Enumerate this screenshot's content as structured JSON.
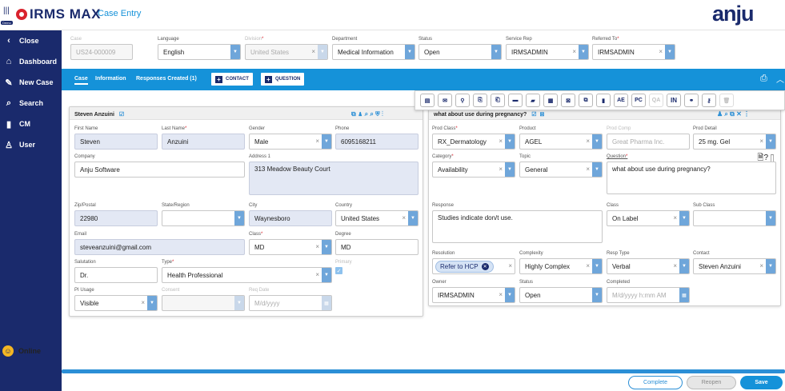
{
  "app": {
    "brand": "IRMS MAX",
    "page": "Case Entry",
    "logo": "anju",
    "env_badge": "Demo"
  },
  "sidebar": {
    "items": [
      {
        "label": "Close",
        "icon": "chevron-left-icon"
      },
      {
        "label": "Dashboard",
        "icon": "home-icon"
      },
      {
        "label": "New Case",
        "icon": "new-case-icon"
      },
      {
        "label": "Search",
        "icon": "search-icon"
      },
      {
        "label": "CM",
        "icon": "bookmark-icon"
      },
      {
        "label": "User",
        "icon": "user-icon"
      }
    ],
    "status": "Online"
  },
  "header": {
    "case": {
      "label": "Case",
      "value": "US24-000009"
    },
    "language": {
      "label": "Language",
      "value": "English"
    },
    "division": {
      "label": "Division",
      "value": "United States"
    },
    "department": {
      "label": "Department",
      "value": "Medical Information"
    },
    "status": {
      "label": "Status",
      "value": "Open"
    },
    "service_rep": {
      "label": "Service Rep",
      "value": "IRMSADMIN"
    },
    "referred_to": {
      "label": "Referred To",
      "value": "IRMSADMIN"
    }
  },
  "tabs": {
    "case": "Case",
    "information": "Information",
    "responses": "Responses Created (1)",
    "contact_btn": "CONTACT",
    "question_btn": "QUESTION"
  },
  "toolbar": {
    "ae": "AE",
    "pc": "PC",
    "qa": "QA",
    "in": "IN"
  },
  "contact": {
    "title": "Steven Anzuini",
    "first_name": {
      "label": "First Name",
      "value": "Steven"
    },
    "last_name": {
      "label": "Last Name",
      "value": "Anzuini"
    },
    "gender": {
      "label": "Gender",
      "value": "Male"
    },
    "phone": {
      "label": "Phone",
      "value": "6095168211"
    },
    "company": {
      "label": "Company",
      "value": "Anju Software"
    },
    "address1": {
      "label": "Address 1",
      "value": "313 Meadow Beauty Court"
    },
    "zip": {
      "label": "Zip/Postal",
      "value": "22980"
    },
    "state": {
      "label": "State/Region",
      "value": ""
    },
    "city": {
      "label": "City",
      "value": "Waynesboro"
    },
    "country": {
      "label": "Country",
      "value": "United States"
    },
    "email": {
      "label": "Email",
      "value": "steveanzuini@gmail.com"
    },
    "class": {
      "label": "Class",
      "value": "MD"
    },
    "degree": {
      "label": "Degree",
      "value": "MD"
    },
    "salutation": {
      "label": "Salutation",
      "value": "Dr."
    },
    "type": {
      "label": "Type",
      "value": "Health Professional"
    },
    "primary": {
      "label": "Primary"
    },
    "pi_usage": {
      "label": "PI Usage",
      "value": "Visible"
    },
    "consent": {
      "label": "Consent",
      "value": ""
    },
    "req_date": {
      "label": "Req Date",
      "placeholder": "M/d/yyyy"
    }
  },
  "question": {
    "title": "what about use during pregnancy?",
    "prod_class": {
      "label": "Prod Class",
      "value": "RX_Dermatology"
    },
    "product": {
      "label": "Product",
      "value": "AGEL"
    },
    "prod_comp": {
      "label": "Prod Comp",
      "placeholder": "Great Pharma Inc."
    },
    "prod_detail": {
      "label": "Prod Detail",
      "value": "25 mg. Gel"
    },
    "category": {
      "label": "Category",
      "value": "Availability"
    },
    "topic": {
      "label": "Topic",
      "value": "General"
    },
    "question_field": {
      "label": "Question",
      "value": "what about use during pregnancy?"
    },
    "response": {
      "label": "Response",
      "value": "Studies indicate don/t use."
    },
    "class": {
      "label": "Class",
      "value": "On Label"
    },
    "sub_class": {
      "label": "Sub Class",
      "value": ""
    },
    "resolution": {
      "label": "Resolution",
      "chip": "Refer to HCP"
    },
    "complexity": {
      "label": "Complexity",
      "value": "Highly Complex"
    },
    "resp_type": {
      "label": "Resp Type",
      "value": "Verbal"
    },
    "contact": {
      "label": "Contact",
      "value": "Steven Anzuini"
    },
    "owner": {
      "label": "Owner",
      "value": "IRMSADMIN"
    },
    "status": {
      "label": "Status",
      "value": "Open"
    },
    "completed": {
      "label": "Completed",
      "placeholder": "M/d/yyyy h:mm AM"
    }
  },
  "footer": {
    "complete": "Complete",
    "reopen": "Reopen",
    "save": "Save"
  },
  "colors": {
    "navy": "#1a2a6c",
    "blue": "#1592d9",
    "dropdown": "#6fa6da",
    "fill": "#e3e8f4",
    "accent_red": "#d9232d",
    "logo_orange": "#f37021"
  }
}
